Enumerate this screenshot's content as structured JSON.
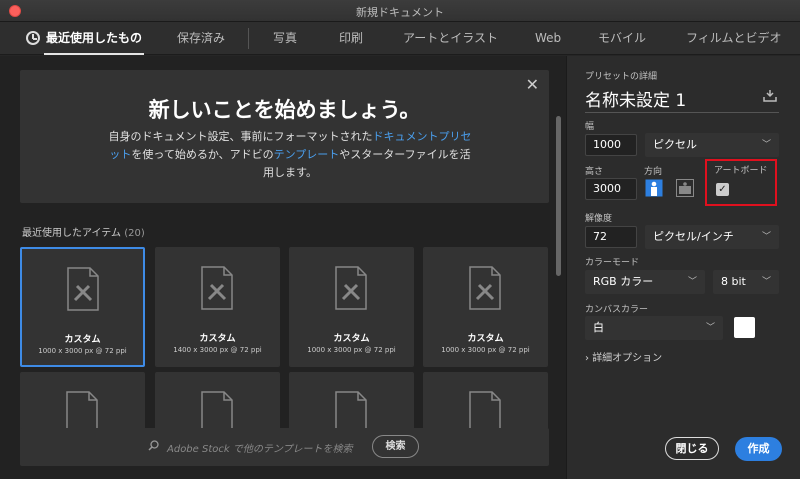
{
  "window": {
    "title": "新規ドキュメント"
  },
  "tabs": [
    {
      "label": "最近使用したもの"
    },
    {
      "label": "保存済み"
    },
    {
      "label": "写真"
    },
    {
      "label": "印刷"
    },
    {
      "label": "アートとイラスト"
    },
    {
      "label": "Web"
    },
    {
      "label": "モバイル"
    },
    {
      "label": "フィルムとビデオ"
    }
  ],
  "hero": {
    "title": "新しいことを始めましょう。",
    "text_1": "自身のドキュメント設定、事前にフォーマットされた",
    "link_1": "ドキュメントプリセット",
    "text_2": "を使って始めるか、アドビの",
    "link_2": "テンプレート",
    "text_3": "やスターターファイルを活用します。"
  },
  "recent": {
    "label": "最近使用したアイテム",
    "count": "(20)"
  },
  "cards": [
    {
      "name": "カスタム",
      "size": "1000 x 3000 px @ 72 ppi"
    },
    {
      "name": "カスタム",
      "size": "1400 x 3000 px @ 72 ppi"
    },
    {
      "name": "カスタム",
      "size": "1000 x 3000 px @ 72 ppi"
    },
    {
      "name": "カスタム",
      "size": "1000 x 3000 px @ 72 ppi"
    }
  ],
  "search": {
    "placeholder": "Adobe Stock で他のテンプレートを検索",
    "button": "検索"
  },
  "preset": {
    "section_label": "プリセットの詳細",
    "name": "名称未設定 1",
    "width_label": "幅",
    "width": "1000",
    "unit": "ピクセル",
    "height_label": "高さ",
    "height": "3000",
    "orientation_label": "方向",
    "artboard_label": "アートボード",
    "artboard_checked": true,
    "resolution_label": "解像度",
    "resolution": "72",
    "resolution_unit": "ピクセル/インチ",
    "color_mode_label": "カラーモード",
    "color_mode": "RGB カラー",
    "bit_depth": "8 bit",
    "canvas_color_label": "カンバスカラー",
    "canvas_color": "白",
    "canvas_swatch": "#ffffff",
    "advanced": "詳細オプション"
  },
  "buttons": {
    "close": "閉じる",
    "create": "作成"
  },
  "colors": {
    "accent": "#2d7fe0",
    "link": "#4a9fee",
    "highlight": "#e0101e"
  }
}
